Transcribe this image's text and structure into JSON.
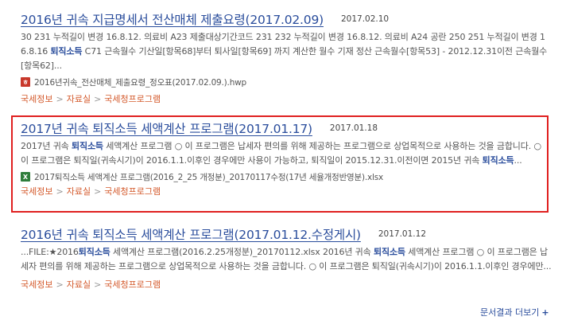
{
  "results": [
    {
      "title": "2016년 귀속 지급명세서 전산매체 제출요령(2017.02.09)",
      "date": "2017.02.10",
      "snippet": [
        {
          "t": "30 231 누적길이 변경 16.8.12. 의료비 A23 제출대상기간코드 231 232 누적길이 변경 16.8.12. 의료비 A24 공란 250 251 누적길이 변경 16.8.16 "
        },
        {
          "t": "퇴직소득",
          "hl": true
        },
        {
          "t": " C71 근속월수 기산일[항목68]부터 퇴사일[항목69] 까지 계산한 월수 기재 정산 근속월수[항목53] - 2012.12.31이전 근속월수[항목62]..."
        }
      ],
      "file": {
        "name": "2016년귀속_전산매체_제출요령_정오표(2017.02.09.).hwp",
        "type": "hwp"
      },
      "breadcrumbs": [
        "국세정보",
        "자료실",
        "국세청프로그램"
      ]
    },
    {
      "title": "2017년 귀속 퇴직소득 세액계산 프로그램(2017.01.17)",
      "date": "2017.01.18",
      "snippet": [
        {
          "t": "2017년 귀속 "
        },
        {
          "t": "퇴직소득",
          "hl": true
        },
        {
          "t": " 세액계산 프로그램 ○ 이 프로그램은 납세자 편의를 위해 제공하는 프로그램으로 상업목적으로 사용하는 것을 금합니다. ○ 이 프로그램은 퇴직일(귀속시기)이 2016.1.1.이후인 경우에만 사용이 가능하고, 퇴직일이 2015.12.31.이전이면 2015년 귀속 "
        },
        {
          "t": "퇴직소득",
          "hl": true
        },
        {
          "t": "..."
        }
      ],
      "file": {
        "name": "2017퇴직소득 세액계산 프로그램(2016_2_25 개정분)_20170117수정(17년 세율개정반영분).xlsx",
        "type": "xlsx"
      },
      "breadcrumbs": [
        "국세정보",
        "자료실",
        "국세청프로그램"
      ]
    },
    {
      "title": "2016년 귀속 퇴직소득 세액계산 프로그램(2017.01.12.수정게시)",
      "date": "2017.01.12",
      "snippet": [
        {
          "t": "...FILE:★2016"
        },
        {
          "t": "퇴직소득",
          "hl": true
        },
        {
          "t": " 세액계산 프로그램(2016.2.25개정분)_20170112.xlsx 2016년 귀속 "
        },
        {
          "t": "퇴직소득",
          "hl": true
        },
        {
          "t": " 세액계산 프로그램 ○ 이 프로그램은 납세자 편의를 위해 제공하는 프로그램으로 상업목적으로 사용하는 것을 금합니다. ○ 이 프로그램은 퇴직일(귀속시기)이 2016.1.1.이후인 경우에만..."
        }
      ],
      "file": null,
      "breadcrumbs": [
        "국세정보",
        "자료실",
        "국세청프로그램"
      ]
    }
  ],
  "more_link": "문서결과 더보기",
  "more_icon": "+",
  "highlight_color": "#e0201f"
}
